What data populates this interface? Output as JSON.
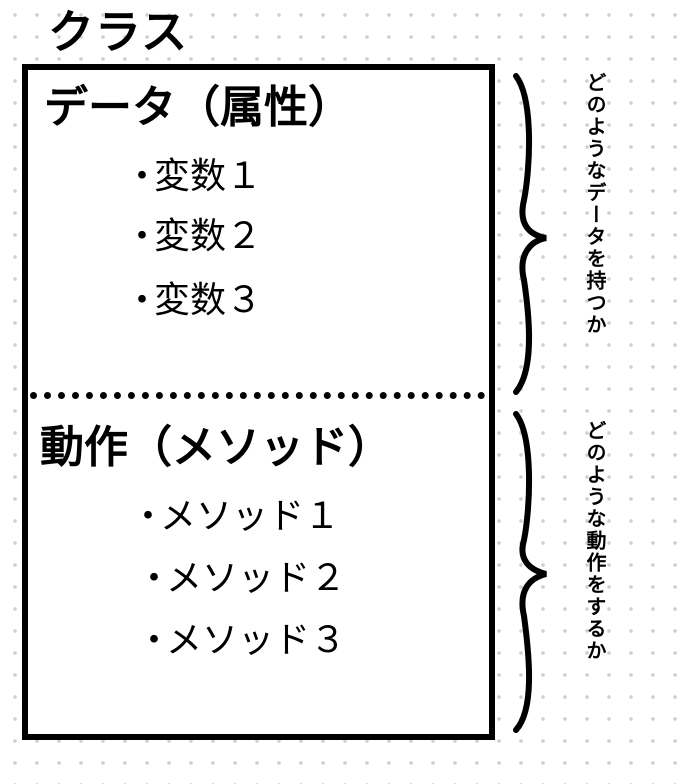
{
  "class_label": "クラス",
  "data_section": {
    "heading": "データ（属性）",
    "items": [
      "変数１",
      "変数２",
      "変数３"
    ]
  },
  "method_section": {
    "heading": "動作（メソッド）",
    "items": [
      "メソッド１",
      "メソッド２",
      "メソッド３"
    ]
  },
  "annotations": {
    "data_note": "どのようなデータを持つか",
    "method_note": "どのような動作をするか"
  },
  "bullet": "・",
  "colors": {
    "line": "#000000",
    "background": "#ffffff",
    "grid_dot": "#cfcfcf"
  }
}
